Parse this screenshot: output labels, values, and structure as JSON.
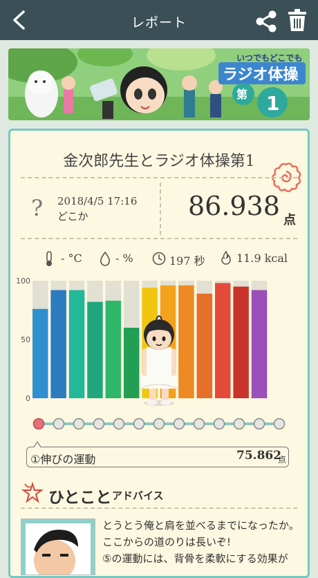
{
  "header": {
    "title": "レポート"
  },
  "banner": {
    "tagline": "いつでもどこでも",
    "program": "ラジオ体操",
    "part_prefix": "第",
    "part_number": "1"
  },
  "report": {
    "song_title": "金次郎先生とラジオ体操第1",
    "weather_symbol": "?",
    "date": "2018/4/5 17:16",
    "location": "どこか",
    "score": "86.938",
    "score_unit": "点"
  },
  "stats": {
    "temperature": "- °C",
    "humidity": "- %",
    "duration": "197 秒",
    "calories": "11.9 kcal"
  },
  "chart_data": {
    "type": "bar",
    "title": "",
    "ylim": [
      0,
      100
    ],
    "ticks": [
      "100",
      "50",
      "0"
    ],
    "values": [
      76,
      92,
      92,
      82,
      83,
      60,
      94,
      96,
      96,
      89,
      98,
      95,
      92
    ],
    "colors": [
      "#2f8fd0",
      "#2c7bbf",
      "#22b89a",
      "#20a67e",
      "#2eb768",
      "#229f55",
      "#f2c511",
      "#f4a21b",
      "#ed8a24",
      "#e66f2a",
      "#e34a3a",
      "#c9332b",
      "#9b4fb8"
    ],
    "track_color": "#e2e0d2"
  },
  "exercise_selector": {
    "selected_index": 0,
    "count": 13
  },
  "selected_exercise": {
    "name": "①伸びの運動",
    "score": "75.862",
    "unit": "点"
  },
  "advice": {
    "title": "ひとこと",
    "subtitle": "アドバイス",
    "lines": [
      "とうとう俺と肩を並べるまでになったか。ここからの道のりは長いぞ!",
      "⑤の運動には、背骨を柔軟にする効果が"
    ]
  }
}
